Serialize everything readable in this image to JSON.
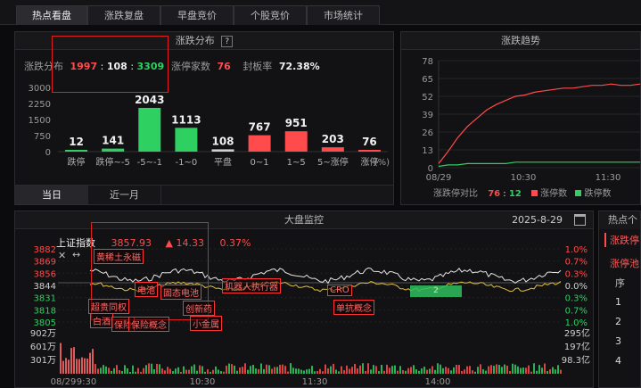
{
  "tabs": [
    "热点看盘",
    "涨跌复盘",
    "早盘竞价",
    "个股竞价",
    "市场统计"
  ],
  "dist_panel": {
    "title": "涨跌分布",
    "help_icon": "?",
    "summary_label": "涨跌分布",
    "up": "1997",
    "sep1": ":",
    "flat": "108",
    "sep2": ":",
    "down": "3309",
    "limit_label": "涨停家数",
    "limit_value": "76",
    "seal_label": "封板率",
    "seal_value": "72.38%",
    "yticks": [
      "3000",
      "2250",
      "1500",
      "750",
      "0"
    ],
    "unit": "(%)",
    "subtabs": [
      "当日",
      "近一月"
    ]
  },
  "chart_data": [
    {
      "type": "bar",
      "title": "涨跌分布",
      "categories": [
        "跌停",
        "跌停~-5",
        "-5~-1",
        "-1~0",
        "平盘",
        "0~1",
        "1~5",
        "5~涨停",
        "涨停"
      ],
      "values": [
        12,
        141,
        2043,
        1113,
        108,
        767,
        951,
        203,
        76
      ],
      "colors": [
        "#2dd061",
        "#2dd061",
        "#2dd061",
        "#2dd061",
        "#cfcfcf",
        "#ff4b4b",
        "#ff4b4b",
        "#ff4b4b",
        "#ff4b4b"
      ],
      "ylim": [
        0,
        3000
      ]
    },
    {
      "type": "line",
      "title": "涨跌趋势",
      "x_ticks": [
        "08/29",
        "10:30",
        "11:30"
      ],
      "yticks": [
        0,
        13,
        26,
        39,
        52,
        65,
        78
      ],
      "ylim": [
        0,
        78
      ],
      "series": [
        {
          "name": "涨停数",
          "color": "#ff4b4b",
          "values": [
            3,
            12,
            22,
            30,
            36,
            42,
            46,
            49,
            52,
            53,
            55,
            56,
            57,
            58,
            58,
            59,
            60,
            60,
            61,
            60,
            60,
            61
          ]
        },
        {
          "name": "跌停数",
          "color": "#2dd061",
          "values": [
            1,
            2,
            2,
            3,
            3,
            3,
            3,
            3,
            4,
            4,
            4,
            4,
            4,
            4,
            4,
            4,
            4,
            4,
            4,
            4,
            4,
            4
          ]
        }
      ]
    }
  ],
  "trend_panel": {
    "title": "涨跌趋势",
    "legend_label": "涨跌停对比",
    "up_count": "76",
    "sep": ":",
    "down_count": "12",
    "up_legend": "涨停数",
    "down_legend": "跌停数"
  },
  "monitor": {
    "title": "大盘监控",
    "date": "2025-8-29",
    "index_name": "上证指数",
    "index_value": "3857.93",
    "change_arrow": "▲",
    "change_value": "14.33",
    "change_pct": "0.37%",
    "yticks_left": [
      "3882",
      "3869",
      "3856",
      "3844",
      "3831",
      "3818",
      "3805"
    ],
    "yticks_right": [
      "1.0%",
      "0.7%",
      "0.3%",
      "0.0%",
      "0.3%",
      "0.7%",
      "1.0%"
    ],
    "vol_left": [
      "902万",
      "601万",
      "301万"
    ],
    "vol_right": [
      "295亿",
      "197亿",
      "98.3亿"
    ],
    "x_ticks": [
      "08/29",
      "9:30",
      "10:30",
      "11:30",
      "14:00"
    ],
    "annotations": [
      "黄稀土永磁",
      "电池",
      "固态电池",
      "机器人执行器",
      "CRO",
      "超贵同权",
      "白酒",
      "保险",
      "保险概念",
      "创新药",
      "小金属",
      "单抗概念"
    ],
    "green_bar_label": "2"
  },
  "right_panel": {
    "title": "热点个",
    "tab1": "涨跌停",
    "tab2": "涨停池",
    "header": "序",
    "rows": [
      "1",
      "2",
      "3",
      "4"
    ]
  }
}
